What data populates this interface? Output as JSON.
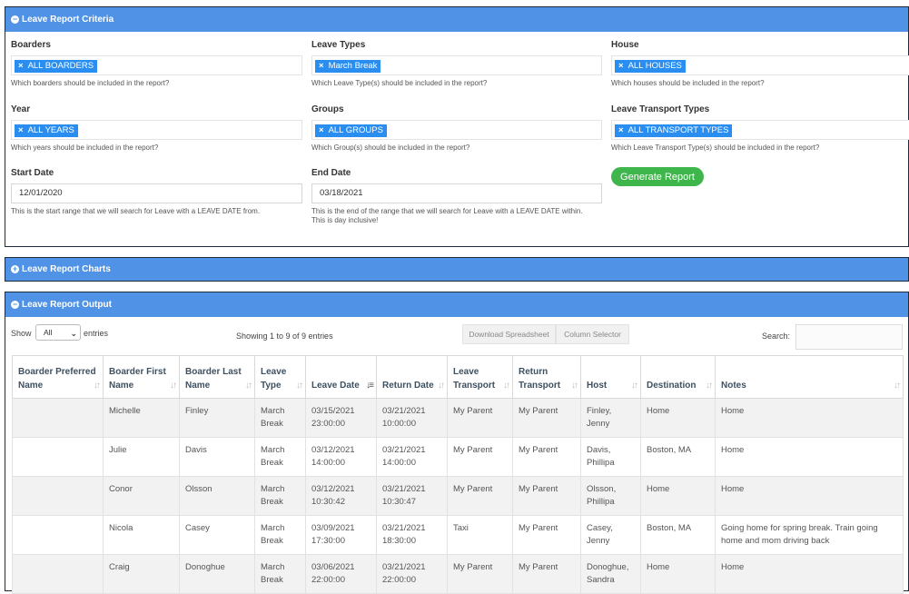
{
  "criteria": {
    "title": "Leave Report Criteria",
    "toggle": "−",
    "boarders": {
      "label": "Boarders",
      "tag": "ALL BOARDERS",
      "hint": "Which boarders should be included in the report?"
    },
    "leave_types": {
      "label": "Leave Types",
      "tag": "March Break",
      "hint": "Which Leave Type(s) should be included in the report?"
    },
    "house": {
      "label": "House",
      "tag": "ALL HOUSES",
      "hint": "Which houses should be included in the report?"
    },
    "year": {
      "label": "Year",
      "tag": "ALL YEARS",
      "hint": "Which years should be included in the report?"
    },
    "groups": {
      "label": "Groups",
      "tag": "ALL GROUPS",
      "hint": "Which Group(s) should be included in the report?"
    },
    "transport": {
      "label": "Leave Transport Types",
      "tag": "ALL TRANSPORT TYPES",
      "hint": "Which Leave Transport Type(s) should be included in the report?"
    },
    "start_date": {
      "label": "Start Date",
      "value": "12/01/2020",
      "hint": "This is the start range that we will search for Leave with a LEAVE DATE from."
    },
    "end_date": {
      "label": "End Date",
      "value": "03/18/2021",
      "hint1": "This is the end of the range that we will search for Leave with a LEAVE DATE within.",
      "hint2": "This is day inclusive!"
    },
    "generate_label": "Generate Report",
    "tag_remove": "×"
  },
  "charts": {
    "title": "Leave Report Charts",
    "toggle": "+"
  },
  "output": {
    "title": "Leave Report Output",
    "toggle": "−",
    "show_label": "Show",
    "entries_label": "entries",
    "length_value": "All",
    "info": "Showing 1 to 9 of 9 entries",
    "download_label": "Download Spreadsheet",
    "column_selector_label": "Column Selector",
    "search_label": "Search:",
    "search_value": "",
    "columns": [
      "Boarder Preferred Name",
      "Boarder First Name",
      "Boarder Last Name",
      "Leave Type",
      "Leave Date",
      "Return Date",
      "Leave Transport",
      "Return Transport",
      "Host",
      "Destination",
      "Notes"
    ],
    "rows": [
      {
        "preferred": "",
        "first": "Michelle",
        "last": "Finley",
        "type": "March Break",
        "leave_date": "03/15/2021 23:00:00",
        "return_date": "03/21/2021 10:00:00",
        "leave_transport": "My Parent",
        "return_transport": "My Parent",
        "host": "Finley, Jenny",
        "destination": "Home",
        "notes": "Home"
      },
      {
        "preferred": "",
        "first": "Julie",
        "last": "Davis",
        "type": "March Break",
        "leave_date": "03/12/2021 14:00:00",
        "return_date": "03/21/2021 14:00:00",
        "leave_transport": "My Parent",
        "return_transport": "My Parent",
        "host": "Davis, Phillipa",
        "destination": "Boston, MA",
        "notes": "Home"
      },
      {
        "preferred": "",
        "first": "Conor",
        "last": "Olsson",
        "type": "March Break",
        "leave_date": "03/12/2021 10:30:42",
        "return_date": "03/21/2021 10:30:47",
        "leave_transport": "My Parent",
        "return_transport": "My Parent",
        "host": "Olsson, Phillipa",
        "destination": "Home",
        "notes": "Home"
      },
      {
        "preferred": "",
        "first": "Nicola",
        "last": "Casey",
        "type": "March Break",
        "leave_date": "03/09/2021 17:30:00",
        "return_date": "03/21/2021 18:30:00",
        "leave_transport": "Taxi",
        "return_transport": "My Parent",
        "host": "Casey, Jenny",
        "destination": "Boston, MA",
        "notes": "Going home for spring break. Train going home and mom driving back"
      },
      {
        "preferred": "",
        "first": "Craig",
        "last": "Donoghue",
        "type": "March Break",
        "leave_date": "03/06/2021 22:00:00",
        "return_date": "03/21/2021 22:00:00",
        "leave_transport": "My Parent",
        "return_transport": "My Parent",
        "host": "Donoghue, Sandra",
        "destination": "Home",
        "notes": "Home"
      }
    ]
  }
}
